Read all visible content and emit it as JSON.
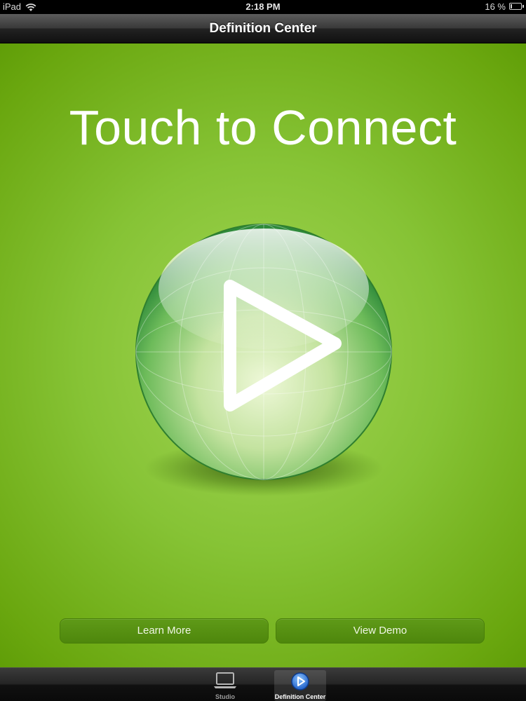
{
  "status_bar": {
    "device": "iPad",
    "time": "2:18 PM",
    "battery_text": "16 %",
    "battery_level": 0.16
  },
  "nav": {
    "title": "Definition Center"
  },
  "main": {
    "headline": "Touch to Connect",
    "learn_more_label": "Learn More",
    "view_demo_label": "View Demo",
    "play_icon": "play-icon"
  },
  "tabs": [
    {
      "label": "Studio",
      "icon": "laptop-icon",
      "selected": false
    },
    {
      "label": "Definition Center",
      "icon": "play-circle-icon",
      "selected": true
    }
  ],
  "colors": {
    "accent_green": "#86c335",
    "button_green": "#5a9414",
    "tab_selected_blue": "#2b6fd6"
  }
}
